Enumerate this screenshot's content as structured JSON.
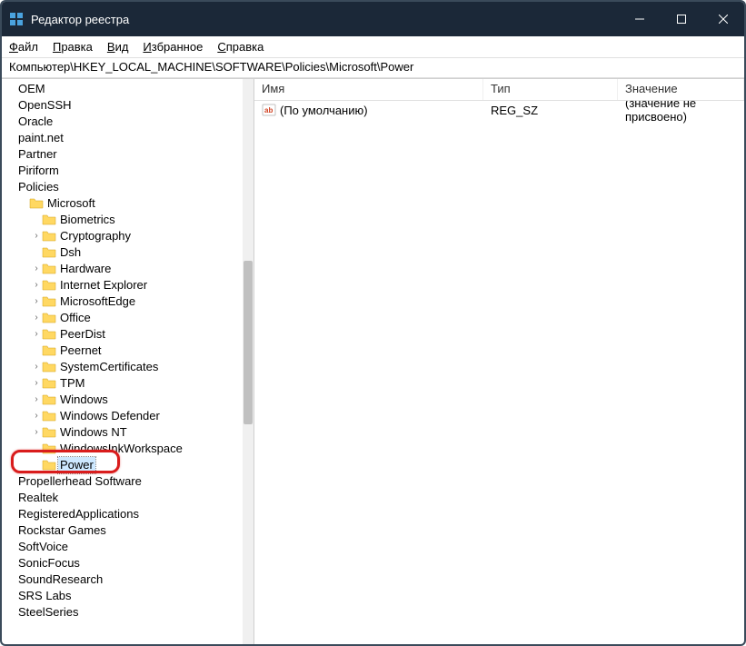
{
  "window": {
    "title": "Редактор реестра"
  },
  "menu": {
    "file": "Файл",
    "edit": "Правка",
    "view": "Вид",
    "favorites": "Избранное",
    "help": "Справка"
  },
  "address": "Компьютер\\HKEY_LOCAL_MACHINE\\SOFTWARE\\Policies\\Microsoft\\Power",
  "columns": {
    "name": "Имя",
    "type": "Тип",
    "value": "Значение"
  },
  "tree": {
    "items": [
      {
        "label": "OEM",
        "indent": 0,
        "expand": "",
        "icon": false
      },
      {
        "label": "OpenSSH",
        "indent": 0,
        "expand": "",
        "icon": false
      },
      {
        "label": "Oracle",
        "indent": 0,
        "expand": "",
        "icon": false
      },
      {
        "label": "paint.net",
        "indent": 0,
        "expand": "",
        "icon": false
      },
      {
        "label": "Partner",
        "indent": 0,
        "expand": "",
        "icon": false
      },
      {
        "label": "Piriform",
        "indent": 0,
        "expand": "",
        "icon": false
      },
      {
        "label": "Policies",
        "indent": 0,
        "expand": "",
        "icon": false
      },
      {
        "label": "Microsoft",
        "indent": 1,
        "expand": "",
        "icon": true
      },
      {
        "label": "Biometrics",
        "indent": 2,
        "expand": "",
        "icon": true
      },
      {
        "label": "Cryptography",
        "indent": 2,
        "expand": "›",
        "icon": true
      },
      {
        "label": "Dsh",
        "indent": 2,
        "expand": "",
        "icon": true
      },
      {
        "label": "Hardware",
        "indent": 2,
        "expand": "›",
        "icon": true
      },
      {
        "label": "Internet Explorer",
        "indent": 2,
        "expand": "›",
        "icon": true
      },
      {
        "label": "MicrosoftEdge",
        "indent": 2,
        "expand": "›",
        "icon": true
      },
      {
        "label": "Office",
        "indent": 2,
        "expand": "›",
        "icon": true
      },
      {
        "label": "PeerDist",
        "indent": 2,
        "expand": "›",
        "icon": true
      },
      {
        "label": "Peernet",
        "indent": 2,
        "expand": "",
        "icon": true
      },
      {
        "label": "SystemCertificates",
        "indent": 2,
        "expand": "›",
        "icon": true
      },
      {
        "label": "TPM",
        "indent": 2,
        "expand": "›",
        "icon": true
      },
      {
        "label": "Windows",
        "indent": 2,
        "expand": "›",
        "icon": true
      },
      {
        "label": "Windows Defender",
        "indent": 2,
        "expand": "›",
        "icon": true
      },
      {
        "label": "Windows NT",
        "indent": 2,
        "expand": "›",
        "icon": true
      },
      {
        "label": "WindowsInkWorkspace",
        "indent": 2,
        "expand": "",
        "icon": true
      },
      {
        "label": "Power",
        "indent": 2,
        "expand": "",
        "icon": true,
        "selected": true
      },
      {
        "label": "Propellerhead Software",
        "indent": 0,
        "expand": "",
        "icon": false
      },
      {
        "label": "Realtek",
        "indent": 0,
        "expand": "",
        "icon": false
      },
      {
        "label": "RegisteredApplications",
        "indent": 0,
        "expand": "",
        "icon": false
      },
      {
        "label": "Rockstar Games",
        "indent": 0,
        "expand": "",
        "icon": false
      },
      {
        "label": "SoftVoice",
        "indent": 0,
        "expand": "",
        "icon": false
      },
      {
        "label": "SonicFocus",
        "indent": 0,
        "expand": "",
        "icon": false
      },
      {
        "label": "SoundResearch",
        "indent": 0,
        "expand": "",
        "icon": false
      },
      {
        "label": "SRS Labs",
        "indent": 0,
        "expand": "",
        "icon": false
      },
      {
        "label": "SteelSeries",
        "indent": 0,
        "expand": "",
        "icon": false
      }
    ]
  },
  "values": [
    {
      "name": "(По умолчанию)",
      "type": "REG_SZ",
      "value": "(значение не присвоено)"
    }
  ]
}
